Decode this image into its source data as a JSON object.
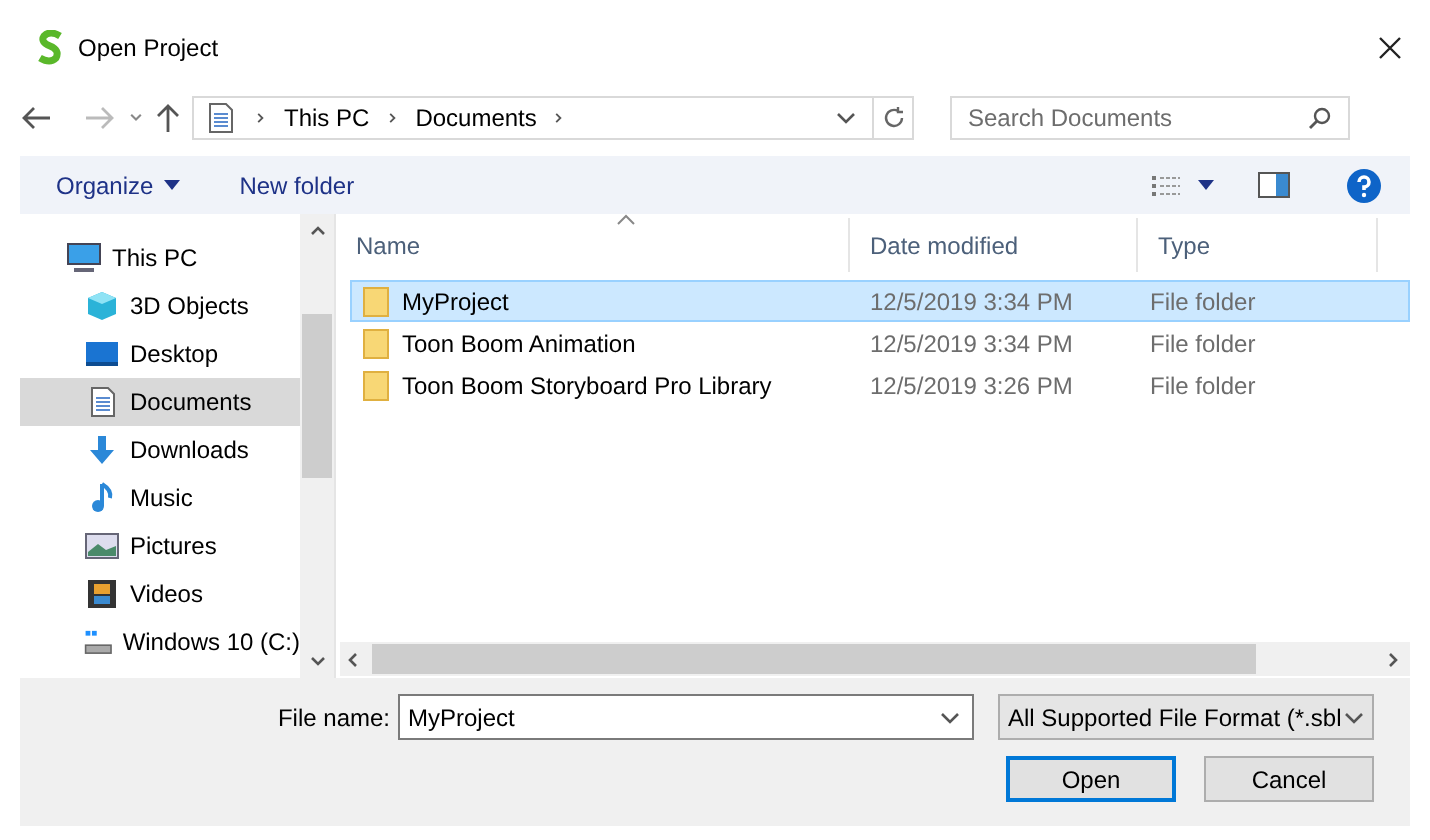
{
  "window": {
    "title": "Open Project"
  },
  "nav": {
    "breadcrumb": [
      "This PC",
      "Documents"
    ],
    "search": {
      "placeholder": "Search Documents"
    }
  },
  "toolbar": {
    "organize": "Organize",
    "new_folder": "New folder"
  },
  "sidebar": {
    "items": [
      {
        "label": "This PC",
        "kind": "pc",
        "selected": false,
        "children": [
          {
            "label": "3D Objects",
            "kind": "cube",
            "selected": false
          },
          {
            "label": "Desktop",
            "kind": "desktop",
            "selected": false
          },
          {
            "label": "Documents",
            "kind": "doc",
            "selected": true
          },
          {
            "label": "Downloads",
            "kind": "download",
            "selected": false
          },
          {
            "label": "Music",
            "kind": "music",
            "selected": false
          },
          {
            "label": "Pictures",
            "kind": "pictures",
            "selected": false
          },
          {
            "label": "Videos",
            "kind": "videos",
            "selected": false
          },
          {
            "label": "Windows 10 (C:)",
            "kind": "drive",
            "selected": false
          }
        ]
      }
    ]
  },
  "table": {
    "columns": [
      "Name",
      "Date modified",
      "Type"
    ],
    "rows": [
      {
        "name": "MyProject",
        "date": "12/5/2019 3:34 PM",
        "type": "File folder",
        "selected": true
      },
      {
        "name": "Toon Boom Animation",
        "date": "12/5/2019 3:34 PM",
        "type": "File folder",
        "selected": false
      },
      {
        "name": "Toon Boom Storyboard Pro Library",
        "date": "12/5/2019 3:26 PM",
        "type": "File folder",
        "selected": false
      }
    ]
  },
  "footer": {
    "file_name_label": "File name:",
    "file_name": "MyProject",
    "filter": "All Supported File Format (*.sbl",
    "buttons": [
      {
        "label": "Open",
        "default": true
      },
      {
        "label": "Cancel",
        "default": false
      }
    ]
  }
}
